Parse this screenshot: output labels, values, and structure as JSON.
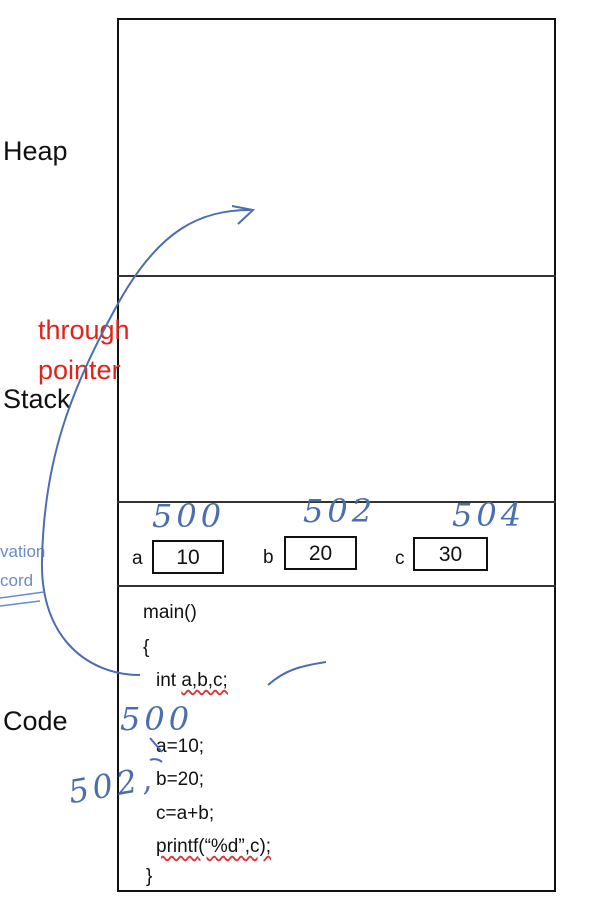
{
  "segments": {
    "heap": "Heap",
    "stack": "Stack",
    "code": "Code"
  },
  "annotation": {
    "line1": "through",
    "line2": "pointer",
    "color": "#e2231a"
  },
  "activation_record": {
    "line1": "vation",
    "line2": "cord"
  },
  "variables": [
    {
      "name": "a",
      "value": "10",
      "address": "500"
    },
    {
      "name": "b",
      "value": "20",
      "address": "502"
    },
    {
      "name": "c",
      "value": "30",
      "address": "504"
    }
  ],
  "code_lines": {
    "main": "main()",
    "open": "{",
    "decl_kw": "int",
    "decl_vars": "a,b,c;",
    "a_assign": "a=10;",
    "b_assign": "b=20;",
    "c_assign": "c=a+b;",
    "printf_fn": "printf",
    "printf_args": "(“%d”,c);",
    "close": "}"
  },
  "handwritten": {
    "addr_a": "500",
    "addr_b": "502,"
  },
  "pen_color": "#4b6eb0"
}
